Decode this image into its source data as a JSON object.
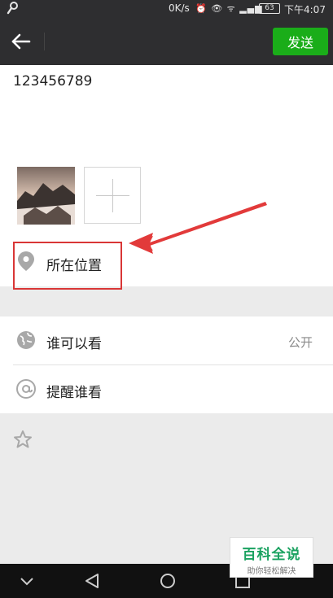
{
  "status_bar": {
    "speed": "0K/s",
    "battery": "63",
    "clock": "下午4:07"
  },
  "title_bar": {
    "send_label": "发送"
  },
  "compose": {
    "post_text": "123456789"
  },
  "location": {
    "label": "所在位置"
  },
  "settings": {
    "visibility_label": "谁可以看",
    "visibility_value": "公开",
    "mention_label": "提醒谁看"
  },
  "watermark": {
    "title": "百科全说",
    "subtitle": "助你轻松解决"
  },
  "icons": [
    "wrench-icon",
    "back-arrow-icon",
    "add-photo-icon",
    "location-pin-icon",
    "globe-icon",
    "at-icon",
    "star-icon",
    "nav-back-icon",
    "nav-home-icon",
    "nav-recents-icon"
  ],
  "colors": {
    "accent": "#1aad19",
    "highlight": "#d93636",
    "dark_bar": "#2e2e30"
  }
}
